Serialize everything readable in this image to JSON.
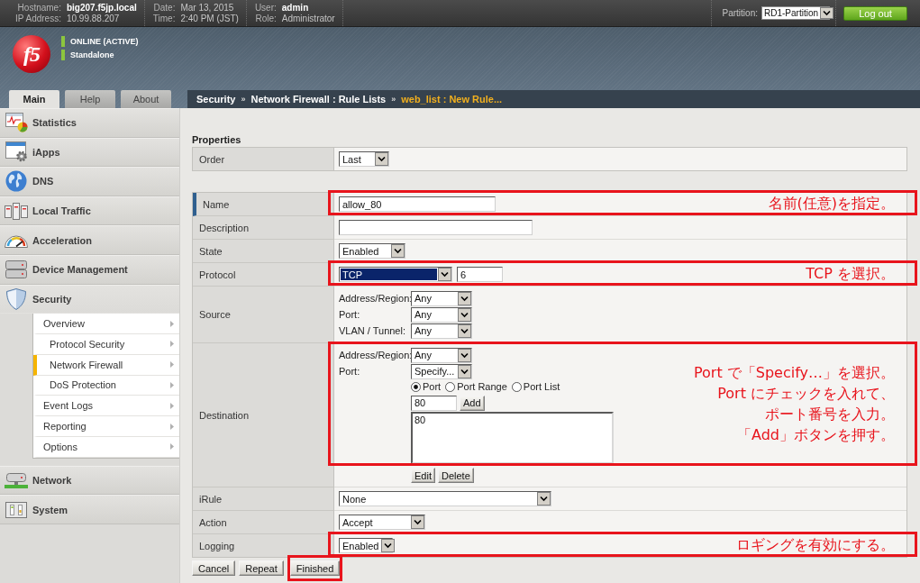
{
  "top_bar": {
    "info_groups": [
      {
        "items": [
          {
            "label": "Hostname:",
            "value": "big207.f5jp.local",
            "strong": true
          },
          {
            "label": "IP Address:",
            "value": "10.99.88.207",
            "strong": false
          }
        ]
      },
      {
        "items": [
          {
            "label": "Date:",
            "value": "Mar 13, 2015",
            "strong": false
          },
          {
            "label": "Time:",
            "value": "2:40 PM (JST)",
            "strong": false
          }
        ]
      },
      {
        "items": [
          {
            "label": "User:",
            "value": "admin",
            "strong": true
          },
          {
            "label": "Role:",
            "value": "Administrator",
            "strong": false
          }
        ]
      }
    ],
    "partition": {
      "label": "Partition:",
      "value": "RD1-Partition"
    },
    "logout_button": "Log out"
  },
  "banner": {
    "logo": "f5",
    "status": [
      "ONLINE (ACTIVE)",
      "Standalone"
    ]
  },
  "nav_tabs": [
    {
      "label": "Main",
      "selected": true
    },
    {
      "label": "Help",
      "selected": false
    },
    {
      "label": "About",
      "selected": false
    }
  ],
  "breadcrumb": [
    {
      "text": "Security",
      "kind": "link"
    },
    {
      "text": "»",
      "kind": "separator"
    },
    {
      "text": "Network Firewall : Rule Lists",
      "kind": "link"
    },
    {
      "text": "»",
      "kind": "separator"
    },
    {
      "text": "web_list : New Rule...",
      "kind": "current"
    }
  ],
  "sidebar": {
    "items": [
      {
        "label": "Statistics",
        "expanded": false
      },
      {
        "label": "iApps",
        "expanded": false
      },
      {
        "label": "DNS",
        "expanded": false
      },
      {
        "label": "Local Traffic",
        "expanded": false
      },
      {
        "label": "Acceleration",
        "expanded": false
      },
      {
        "label": "Device Management",
        "expanded": false
      },
      {
        "label": "Security",
        "expanded": true,
        "children": [
          {
            "label": "Overview",
            "selected": false,
            "children": [
              {
                "label": "Protocol Security",
                "selected": false
              },
              {
                "label": "Network Firewall",
                "selected": true
              },
              {
                "label": "DoS Protection",
                "selected": false
              }
            ]
          },
          {
            "label": "Event Logs",
            "selected": false
          },
          {
            "label": "Reporting",
            "selected": false
          },
          {
            "label": "Options",
            "selected": false
          }
        ]
      },
      {
        "label": "Network",
        "expanded": false
      },
      {
        "label": "System",
        "expanded": false
      }
    ]
  },
  "properties": {
    "heading": "Properties",
    "rows": [
      {
        "label": "Order",
        "kind": "select",
        "required": false,
        "value": "Last",
        "focused": false
      }
    ]
  },
  "rule": {
    "rows": [
      {
        "label": "Name",
        "kind": "text",
        "required": true,
        "value": "allow_80",
        "annotation": [
          "名前(任意)を指定。"
        ]
      },
      {
        "label": "Description",
        "kind": "text",
        "required": false
      },
      {
        "label": "State",
        "kind": "select",
        "required": false,
        "value": "Enabled",
        "focused": false
      },
      {
        "label": "Protocol",
        "kind": "select_number",
        "required": false,
        "value": "TCP",
        "focused": true,
        "number": "6",
        "annotation": [
          "TCP を選択。"
        ]
      },
      {
        "label": "Source",
        "kind": "fields",
        "required": false,
        "fields": [
          {
            "label": "Address/Region:",
            "value": "Any"
          },
          {
            "label": "Port:",
            "value": "Any"
          },
          {
            "label": "VLAN / Tunnel:",
            "value": "Any"
          }
        ]
      },
      {
        "label": "Destination",
        "kind": "destination",
        "required": false,
        "fields": [
          {
            "label": "Address/Region:",
            "value": "Any"
          },
          {
            "label": "Port:",
            "value": "Specify..."
          }
        ],
        "port_types": [
          {
            "label": "Port",
            "selected": true
          },
          {
            "label": "Port Range",
            "selected": false
          },
          {
            "label": "Port List",
            "selected": false
          }
        ],
        "port_input": "80",
        "add_button": "Add",
        "ports": [
          "80"
        ],
        "list_buttons": [
          "Edit",
          "Delete"
        ],
        "annotation": [
          "Port で「Specify…」を選択。",
          "Port にチェックを入れて、",
          "ポート番号を入力。",
          "「Add」ボタンを押す。"
        ]
      },
      {
        "label": "iRule",
        "kind": "select",
        "required": false,
        "value": "None",
        "focused": false
      },
      {
        "label": "Action",
        "kind": "select",
        "required": false,
        "value": "Accept",
        "focused": false
      },
      {
        "label": "Logging",
        "kind": "select",
        "required": false,
        "value": "Enabled",
        "focused": false,
        "annotation": [
          "ロギングを有効にする。"
        ]
      }
    ]
  },
  "actions": [
    {
      "label": "Cancel",
      "highlighted": false
    },
    {
      "label": "Repeat",
      "highlighted": false
    },
    {
      "label": "Finished",
      "highlighted": true
    }
  ]
}
